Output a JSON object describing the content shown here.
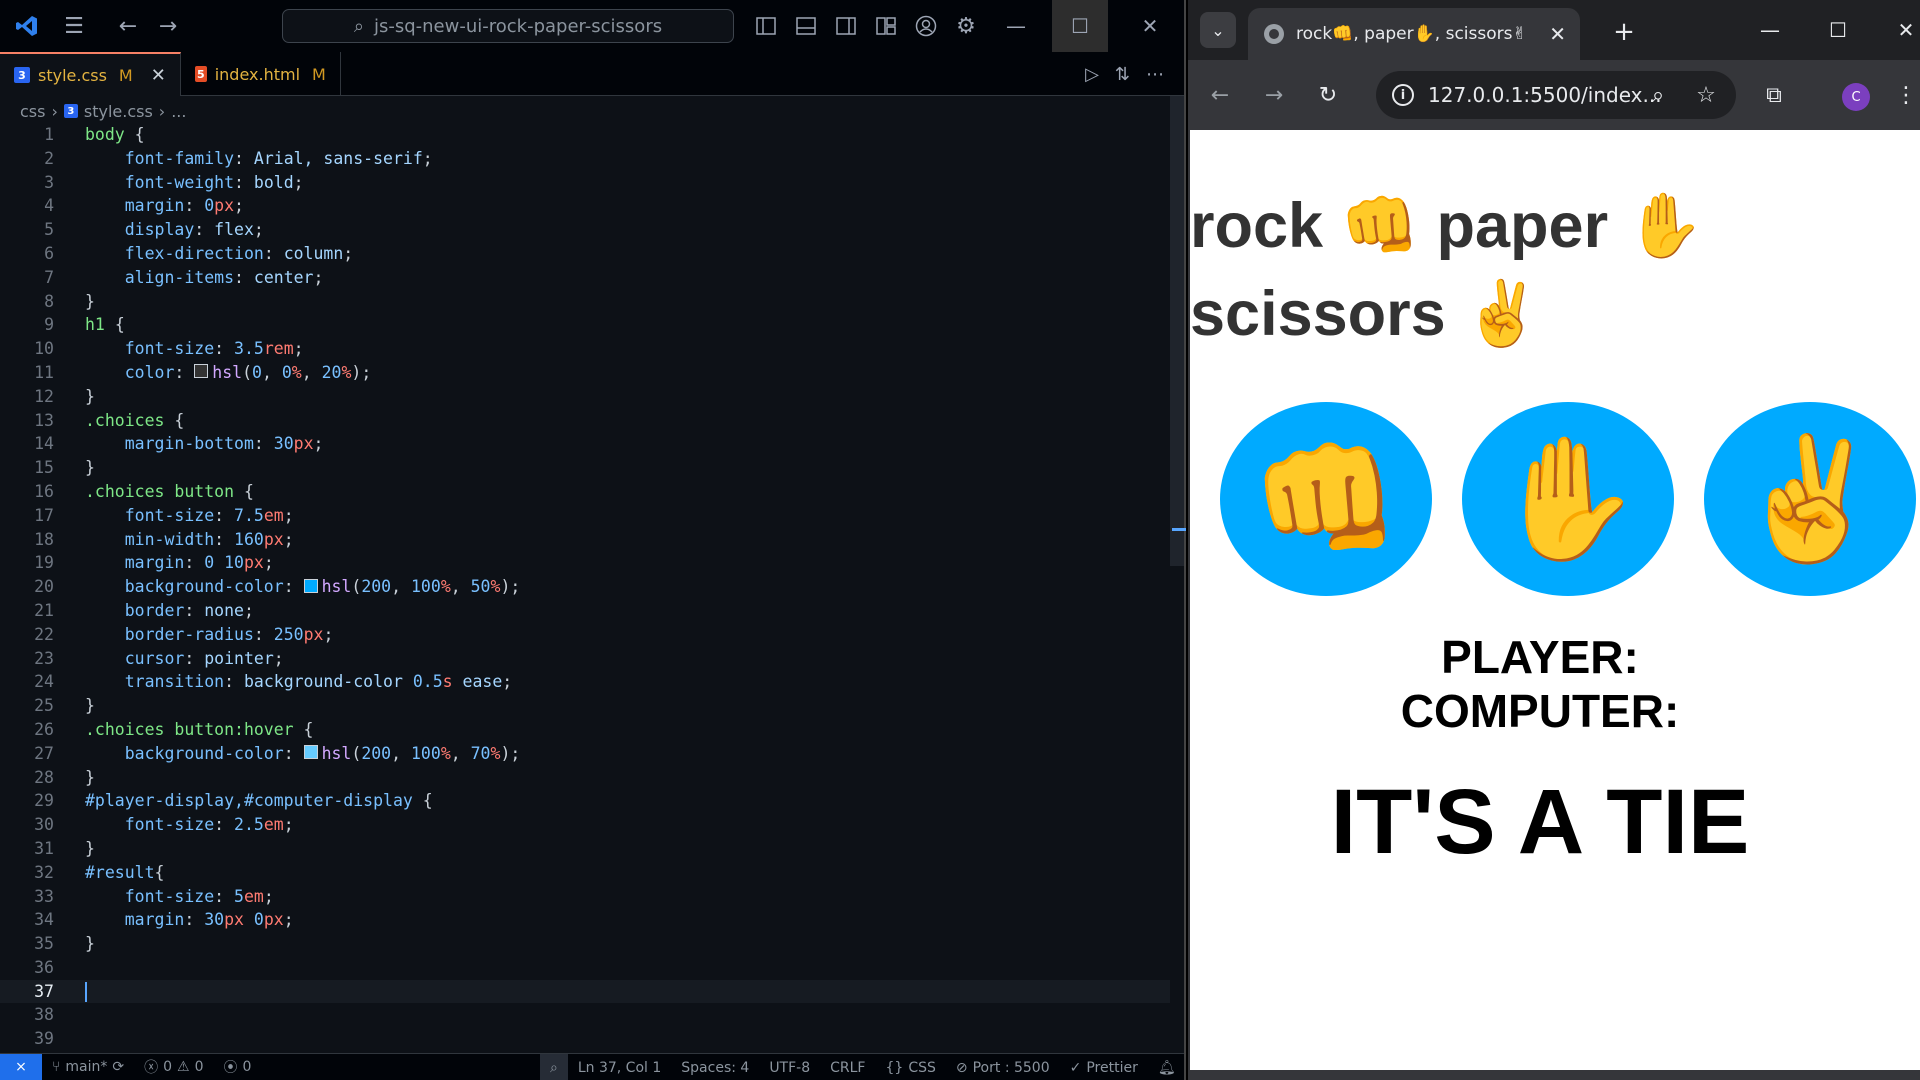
{
  "vscode": {
    "search_text": "js-sq-new-ui-rock-paper-scissors",
    "tabs": [
      {
        "label": "style.css",
        "modified": "M"
      },
      {
        "label": "index.html",
        "modified": "M"
      }
    ],
    "breadcrumb": {
      "folder": "css",
      "file": "style.css",
      "more": "..."
    },
    "code_lines": [
      [
        [
          "body ",
          "t-sel"
        ],
        [
          "{",
          "t-punc"
        ]
      ],
      [
        [
          "    font-family",
          "t-prop"
        ],
        [
          ": ",
          "t-punc"
        ],
        [
          "Arial, sans-serif",
          "t-val"
        ],
        [
          ";",
          "t-punc"
        ]
      ],
      [
        [
          "    font-weight",
          "t-prop"
        ],
        [
          ": ",
          "t-punc"
        ],
        [
          "bold",
          "t-val"
        ],
        [
          ";",
          "t-punc"
        ]
      ],
      [
        [
          "    margin",
          "t-prop"
        ],
        [
          ": ",
          "t-punc"
        ],
        [
          "0",
          "t-num"
        ],
        [
          "px",
          "t-unit"
        ],
        [
          ";",
          "t-punc"
        ]
      ],
      [
        [
          "    display",
          "t-prop"
        ],
        [
          ": ",
          "t-punc"
        ],
        [
          "flex",
          "t-val"
        ],
        [
          ";",
          "t-punc"
        ]
      ],
      [
        [
          "    flex-direction",
          "t-prop"
        ],
        [
          ": ",
          "t-punc"
        ],
        [
          "column",
          "t-val"
        ],
        [
          ";",
          "t-punc"
        ]
      ],
      [
        [
          "    align-items",
          "t-prop"
        ],
        [
          ": ",
          "t-punc"
        ],
        [
          "center",
          "t-val"
        ],
        [
          ";",
          "t-punc"
        ]
      ],
      [
        [
          "}",
          "t-punc"
        ]
      ],
      [
        [
          "h1 ",
          "t-sel"
        ],
        [
          "{",
          "t-punc"
        ]
      ],
      [
        [
          "    font-size",
          "t-prop"
        ],
        [
          ": ",
          "t-punc"
        ],
        [
          "3.5",
          "t-num"
        ],
        [
          "rem",
          "t-unit"
        ],
        [
          ";",
          "t-punc"
        ]
      ],
      [
        [
          "    color",
          "t-prop"
        ],
        [
          ": ",
          "t-punc"
        ],
        [
          "SW:#333333",
          ""
        ],
        [
          "hsl",
          "t-fn"
        ],
        [
          "(",
          "t-punc"
        ],
        [
          "0",
          "t-num"
        ],
        [
          ", ",
          "t-punc"
        ],
        [
          "0",
          "t-num"
        ],
        [
          "%",
          "t-unit"
        ],
        [
          ", ",
          "t-punc"
        ],
        [
          "20",
          "t-num"
        ],
        [
          "%",
          "t-unit"
        ],
        [
          ");",
          "t-punc"
        ]
      ],
      [
        [
          "}",
          "t-punc"
        ]
      ],
      [
        [
          ".choices ",
          "t-sel"
        ],
        [
          "{",
          "t-punc"
        ]
      ],
      [
        [
          "    margin-bottom",
          "t-prop"
        ],
        [
          ": ",
          "t-punc"
        ],
        [
          "30",
          "t-num"
        ],
        [
          "px",
          "t-unit"
        ],
        [
          ";",
          "t-punc"
        ]
      ],
      [
        [
          "}",
          "t-punc"
        ]
      ],
      [
        [
          ".choices button ",
          "t-sel"
        ],
        [
          "{",
          "t-punc"
        ]
      ],
      [
        [
          "    font-size",
          "t-prop"
        ],
        [
          ": ",
          "t-punc"
        ],
        [
          "7.5",
          "t-num"
        ],
        [
          "em",
          "t-unit"
        ],
        [
          ";",
          "t-punc"
        ]
      ],
      [
        [
          "    min-width",
          "t-prop"
        ],
        [
          ": ",
          "t-punc"
        ],
        [
          "160",
          "t-num"
        ],
        [
          "px",
          "t-unit"
        ],
        [
          ";",
          "t-punc"
        ]
      ],
      [
        [
          "    margin",
          "t-prop"
        ],
        [
          ": ",
          "t-punc"
        ],
        [
          "0 ",
          "t-num"
        ],
        [
          "10",
          "t-num"
        ],
        [
          "px",
          "t-unit"
        ],
        [
          ";",
          "t-punc"
        ]
      ],
      [
        [
          "    background-color",
          "t-prop"
        ],
        [
          ": ",
          "t-punc"
        ],
        [
          "SW:#00aaff",
          ""
        ],
        [
          "hsl",
          "t-fn"
        ],
        [
          "(",
          "t-punc"
        ],
        [
          "200",
          "t-num"
        ],
        [
          ", ",
          "t-punc"
        ],
        [
          "100",
          "t-num"
        ],
        [
          "%",
          "t-unit"
        ],
        [
          ", ",
          "t-punc"
        ],
        [
          "50",
          "t-num"
        ],
        [
          "%",
          "t-unit"
        ],
        [
          ");",
          "t-punc"
        ]
      ],
      [
        [
          "    border",
          "t-prop"
        ],
        [
          ": ",
          "t-punc"
        ],
        [
          "none",
          "t-val"
        ],
        [
          ";",
          "t-punc"
        ]
      ],
      [
        [
          "    border-radius",
          "t-prop"
        ],
        [
          ": ",
          "t-punc"
        ],
        [
          "250",
          "t-num"
        ],
        [
          "px",
          "t-unit"
        ],
        [
          ";",
          "t-punc"
        ]
      ],
      [
        [
          "    cursor",
          "t-prop"
        ],
        [
          ": ",
          "t-punc"
        ],
        [
          "pointer",
          "t-val"
        ],
        [
          ";",
          "t-punc"
        ]
      ],
      [
        [
          "    transition",
          "t-prop"
        ],
        [
          ": ",
          "t-punc"
        ],
        [
          "background-color ",
          "t-val"
        ],
        [
          "0.5",
          "t-num"
        ],
        [
          "s",
          "t-unit"
        ],
        [
          " ease",
          "t-val"
        ],
        [
          ";",
          "t-punc"
        ]
      ],
      [
        [
          "}",
          "t-punc"
        ]
      ],
      [
        [
          ".choices button:hover ",
          "t-sel"
        ],
        [
          "{",
          "t-punc"
        ]
      ],
      [
        [
          "    background-color",
          "t-prop"
        ],
        [
          ": ",
          "t-punc"
        ],
        [
          "SW:#66ccff",
          ""
        ],
        [
          "hsl",
          "t-fn"
        ],
        [
          "(",
          "t-punc"
        ],
        [
          "200",
          "t-num"
        ],
        [
          ", ",
          "t-punc"
        ],
        [
          "100",
          "t-num"
        ],
        [
          "%",
          "t-unit"
        ],
        [
          ", ",
          "t-punc"
        ],
        [
          "70",
          "t-num"
        ],
        [
          "%",
          "t-unit"
        ],
        [
          ");",
          "t-punc"
        ]
      ],
      [
        [
          "}",
          "t-punc"
        ]
      ],
      [
        [
          "#player-display,#computer-display ",
          "t-id"
        ],
        [
          "{",
          "t-punc"
        ]
      ],
      [
        [
          "    font-size",
          "t-prop"
        ],
        [
          ": ",
          "t-punc"
        ],
        [
          "2.5",
          "t-num"
        ],
        [
          "em",
          "t-unit"
        ],
        [
          ";",
          "t-punc"
        ]
      ],
      [
        [
          "}",
          "t-punc"
        ]
      ],
      [
        [
          "#result",
          "t-id"
        ],
        [
          "{",
          "t-punc"
        ]
      ],
      [
        [
          "    font-size",
          "t-prop"
        ],
        [
          ": ",
          "t-punc"
        ],
        [
          "5",
          "t-num"
        ],
        [
          "em",
          "t-unit"
        ],
        [
          ";",
          "t-punc"
        ]
      ],
      [
        [
          "    margin",
          "t-prop"
        ],
        [
          ": ",
          "t-punc"
        ],
        [
          "30",
          "t-num"
        ],
        [
          "px ",
          "t-unit"
        ],
        [
          "0",
          "t-num"
        ],
        [
          "px",
          "t-unit"
        ],
        [
          ";",
          "t-punc"
        ]
      ],
      [
        [
          "}",
          "t-punc"
        ]
      ],
      [],
      [],
      [],
      []
    ],
    "current_line": 37,
    "status": {
      "branch": "main*",
      "errors": "0",
      "warnings": "0",
      "ports": "0",
      "position": "Ln 37, Col 1",
      "spaces": "Spaces: 4",
      "encoding": "UTF-8",
      "eol": "CRLF",
      "language": "CSS",
      "port": "Port : 5500",
      "formatter": "Prettier"
    }
  },
  "chrome": {
    "tab_title": "rock👊, paper✋, scissors✌",
    "url": "127.0.0.1:5500/index...",
    "profile_initial": "C",
    "page": {
      "h1_line1": "rock 👊 paper ✋",
      "h1_line2": "scissors ✌",
      "choices": [
        {
          "emoji": "👊",
          "icon": "fist-icon"
        },
        {
          "emoji": "✋",
          "icon": "hand-icon"
        },
        {
          "emoji": "✌",
          "icon": "victory-icon"
        }
      ],
      "player_display": "PLAYER:",
      "computer_display": "COMPUTER:",
      "result": "IT'S A TIE"
    }
  },
  "colors": {
    "button_bg": "#00aaff",
    "vscode_bg": "#0d1117",
    "accent": "#1f6feb"
  }
}
